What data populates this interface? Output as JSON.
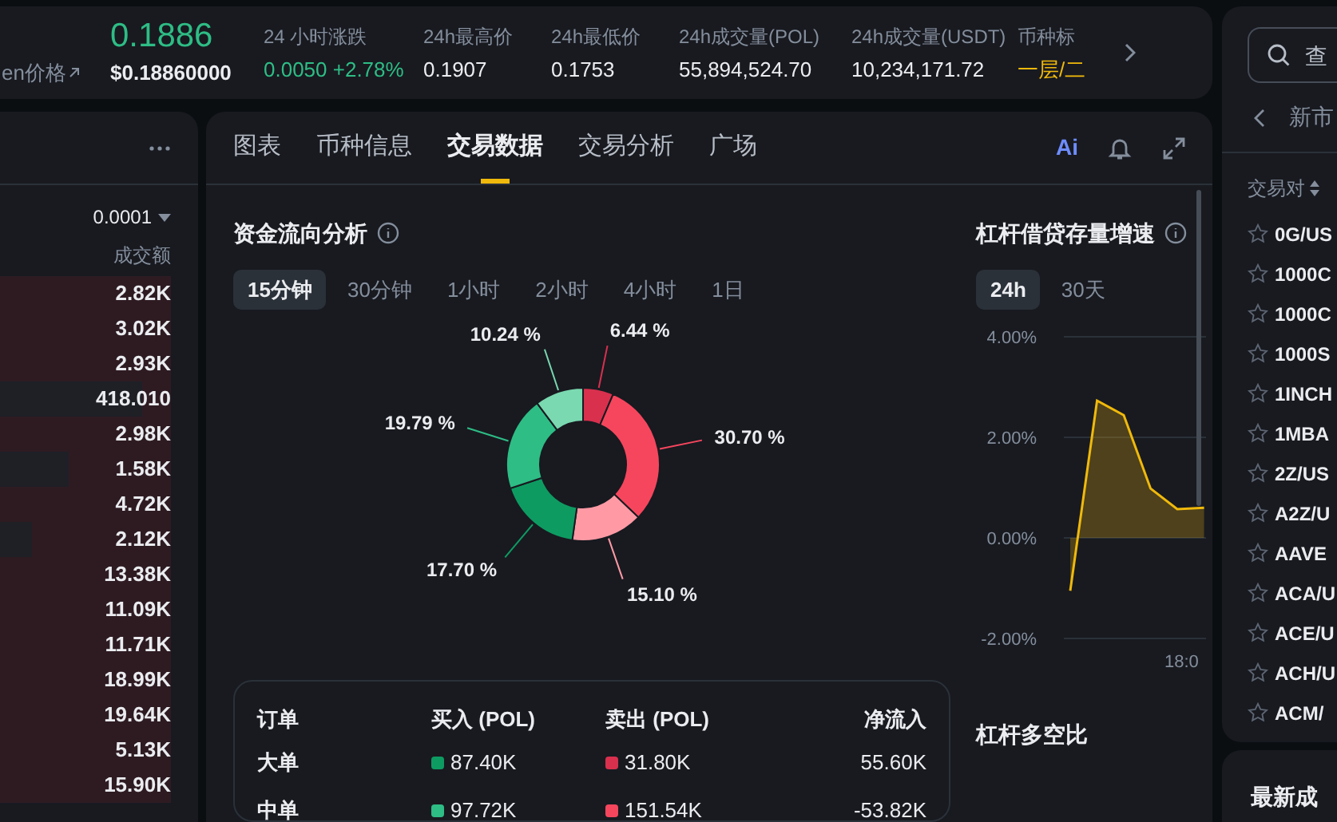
{
  "top_bar": {
    "price_label": "en价格",
    "main_price": "0.1886",
    "usd_price": "$0.18860000",
    "stats": [
      {
        "label": "24 小时涨跌",
        "value": "0.0050 +2.78%",
        "kind": "change"
      },
      {
        "label": "24h最高价",
        "value": "0.1907",
        "kind": "plain"
      },
      {
        "label": "24h最低价",
        "value": "0.1753",
        "kind": "plain"
      },
      {
        "label": "24h成交量(POL)",
        "value": "55,894,524.70",
        "kind": "plain"
      },
      {
        "label": "24h成交量(USDT)",
        "value": "10,234,171.72",
        "kind": "plain"
      },
      {
        "label": "币种标",
        "value": "一层/二",
        "kind": "tag"
      }
    ]
  },
  "order_book": {
    "precision": "0.0001",
    "column": "成交额",
    "rows": [
      {
        "amount": "2.82K",
        "level": 1
      },
      {
        "amount": "3.02K",
        "level": 1
      },
      {
        "amount": "2.93K",
        "level": 1
      },
      {
        "amount": "418.010",
        "level": 0.17
      },
      {
        "amount": "2.98K",
        "level": 1
      },
      {
        "amount": "1.58K",
        "level": 0.6
      },
      {
        "amount": "4.72K",
        "level": 1
      },
      {
        "amount": "2.12K",
        "level": 0.81
      },
      {
        "amount": "13.38K",
        "level": 1
      },
      {
        "amount": "11.09K",
        "level": 1
      },
      {
        "amount": "11.71K",
        "level": 1
      },
      {
        "amount": "18.99K",
        "level": 1
      },
      {
        "amount": "19.64K",
        "level": 1
      },
      {
        "amount": "5.13K",
        "level": 1
      },
      {
        "amount": "15.90K",
        "level": 1
      }
    ]
  },
  "tabs": [
    {
      "label": "图表",
      "selected": false
    },
    {
      "label": "币种信息",
      "selected": false
    },
    {
      "label": "交易数据",
      "selected": true
    },
    {
      "label": "交易分析",
      "selected": false
    },
    {
      "label": "广场",
      "selected": false
    }
  ],
  "ai_label": "Ai",
  "fund_flow": {
    "title": "资金流向分析",
    "periods": [
      {
        "label": "15分钟",
        "selected": true
      },
      {
        "label": "30分钟",
        "selected": false
      },
      {
        "label": "1小时",
        "selected": false
      },
      {
        "label": "2小时",
        "selected": false
      },
      {
        "label": "4小时",
        "selected": false
      },
      {
        "label": "1日",
        "selected": false
      }
    ],
    "chart_data": {
      "type": "donut",
      "values": [
        6.44,
        30.7,
        15.1,
        17.7,
        19.79,
        10.24
      ],
      "value_labels": [
        "6.44 %",
        "30.70 %",
        "15.10 %",
        "17.70 %",
        "19.79 %",
        "10.24 %"
      ]
    },
    "table": {
      "columns": [
        "订单",
        "买入 (POL)",
        "卖出 (POL)",
        "净流入"
      ],
      "rows": [
        {
          "order": "大单",
          "buy": {
            "value": "87.40K",
            "color": "#0e9b62"
          },
          "sell": {
            "value": "31.80K",
            "color": "#d9304e"
          },
          "net": "55.60K"
        },
        {
          "order": "中单",
          "buy": {
            "value": "97.72K",
            "color": "#2ebd85"
          },
          "sell": {
            "value": "151.54K",
            "color": "#f6465d"
          },
          "net": "-53.82K"
        }
      ]
    }
  },
  "leverage_growth": {
    "title": "杠杆借贷存量增速",
    "periods": [
      {
        "label": "24h",
        "selected": true
      },
      {
        "label": "30天",
        "selected": false
      }
    ],
    "time_label": "18:0",
    "chart_data": {
      "type": "area",
      "series": [
        {
          "color": "#f0b90b",
          "values": [
            -1.05,
            2.73,
            2.44,
            0.98,
            0.57,
            0.6
          ]
        }
      ],
      "ylim": [
        -2,
        4
      ],
      "yticks": [
        {
          "value": 4,
          "label": "4.00%"
        },
        {
          "value": 2,
          "label": "2.00%"
        },
        {
          "value": 0,
          "label": "0.00%"
        },
        {
          "value": -2,
          "label": "-2.00%"
        }
      ]
    }
  },
  "leverage_ratio": {
    "title": "杠杆多空比"
  },
  "market": {
    "search_placeholder": "查",
    "category": "新市",
    "column": "交易对",
    "pairs": [
      "0G/US",
      "1000C",
      "1000C",
      "1000S",
      "1INCH",
      "1MBA",
      "2Z/US",
      "A2Z/U",
      "AAVE",
      "ACA/U",
      "ACE/U",
      "ACH/U",
      "ACM/"
    ]
  },
  "latest_trades": {
    "title": "最新成"
  }
}
